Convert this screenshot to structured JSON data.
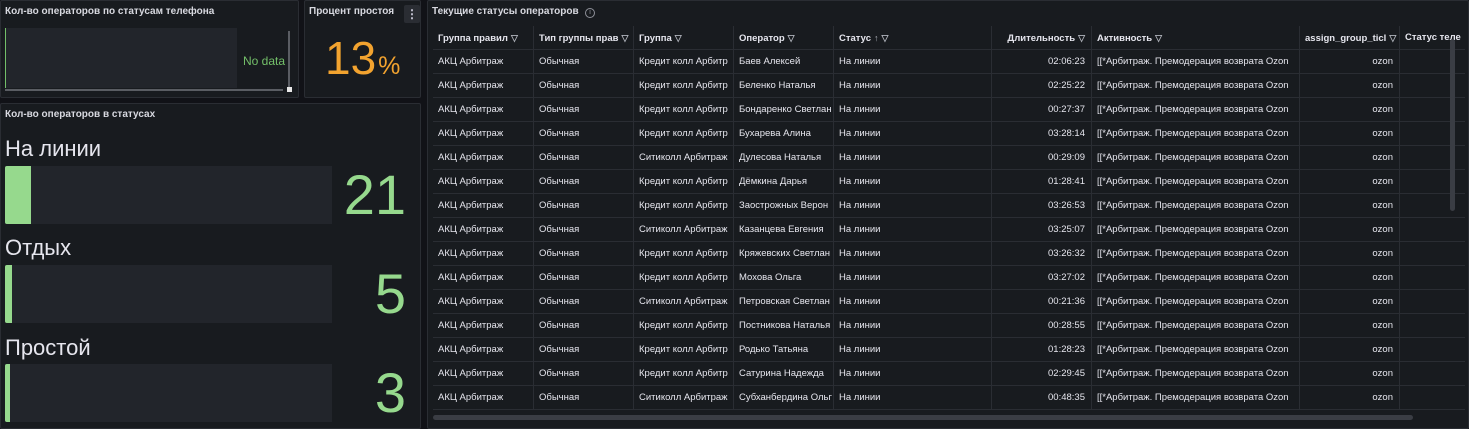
{
  "panel_phone": {
    "title": "Кол-во операторов по статусам телефона",
    "nodata": "No data"
  },
  "panel_idle": {
    "title": "Процент простоя",
    "menu_icon": "kebab-icon",
    "value": "13",
    "unit": "%",
    "color": "#f2a32f"
  },
  "panel_counts": {
    "title": "Кол-во операторов в статусах",
    "items": [
      {
        "label": "На линии",
        "value": "21",
        "fraction": 0.08
      },
      {
        "label": "Отдых",
        "value": "5",
        "fraction": 0.02
      },
      {
        "label": "Простой",
        "value": "3",
        "fraction": 0.012
      }
    ],
    "color": "#96d98d"
  },
  "panel_table": {
    "title": "Текущие статусы операторов",
    "info_icon": "info-icon",
    "columns": [
      "Группа правил",
      "Тип группы прав",
      "Группа",
      "Оператор",
      "Статус",
      "Длительность",
      "Активность",
      "assign_group_ticl",
      "Статус теле"
    ],
    "sort_icon": "↑",
    "rows": [
      [
        "АКЦ Арбитраж",
        "Обычная",
        "Кредит колл Арбитр",
        "Баев Алексей",
        "На линии",
        "02:06:23",
        "[[*Арбитраж. Премодерация возврата Ozon",
        "ozon"
      ],
      [
        "АКЦ Арбитраж",
        "Обычная",
        "Кредит колл Арбитр",
        "Беленко Наталья",
        "На линии",
        "02:25:22",
        "[[*Арбитраж. Премодерация возврата Ozon",
        "ozon"
      ],
      [
        "АКЦ Арбитраж",
        "Обычная",
        "Кредит колл Арбитр",
        "Бондаренко Светлан",
        "На линии",
        "00:27:37",
        "[[*Арбитраж. Премодерация возврата Ozon",
        "ozon"
      ],
      [
        "АКЦ Арбитраж",
        "Обычная",
        "Кредит колл Арбитр",
        "Бухарева Алина",
        "На линии",
        "03:28:14",
        "[[*Арбитраж. Премодерация возврата Ozon",
        "ozon"
      ],
      [
        "АКЦ Арбитраж",
        "Обычная",
        "Ситиколл Арбитраж",
        "Дулесова Наталья",
        "На линии",
        "00:29:09",
        "[[*Арбитраж. Премодерация возврата Ozon",
        "ozon"
      ],
      [
        "АКЦ Арбитраж",
        "Обычная",
        "Кредит колл Арбитр",
        "Дёмкина Дарья",
        "На линии",
        "01:28:41",
        "[[*Арбитраж. Премодерация возврата Ozon",
        "ozon"
      ],
      [
        "АКЦ Арбитраж",
        "Обычная",
        "Кредит колл Арбитр",
        "Заострожных Верон",
        "На линии",
        "03:26:53",
        "[[*Арбитраж. Премодерация возврата Ozon",
        "ozon"
      ],
      [
        "АКЦ Арбитраж",
        "Обычная",
        "Ситиколл Арбитраж",
        "Казанцева Евгения",
        "На линии",
        "03:25:07",
        "[[*Арбитраж. Премодерация возврата Ozon",
        "ozon"
      ],
      [
        "АКЦ Арбитраж",
        "Обычная",
        "Кредит колл Арбитр",
        "Кряжевских Светлан",
        "На линии",
        "03:26:32",
        "[[*Арбитраж. Премодерация возврата Ozon",
        "ozon"
      ],
      [
        "АКЦ Арбитраж",
        "Обычная",
        "Кредит колл Арбитр",
        "Мохова Ольга",
        "На линии",
        "03:27:02",
        "[[*Арбитраж. Премодерация возврата Ozon",
        "ozon"
      ],
      [
        "АКЦ Арбитраж",
        "Обычная",
        "Ситиколл Арбитраж",
        "Петровская Светлан",
        "На линии",
        "00:21:36",
        "[[*Арбитраж. Премодерация возврата Ozon",
        "ozon"
      ],
      [
        "АКЦ Арбитраж",
        "Обычная",
        "Кредит колл Арбитр",
        "Постникова Наталья",
        "На линии",
        "00:28:55",
        "[[*Арбитраж. Премодерация возврата Ozon",
        "ozon"
      ],
      [
        "АКЦ Арбитраж",
        "Обычная",
        "Кредит колл Арбитр",
        "Родько Татьяна",
        "На линии",
        "01:28:23",
        "[[*Арбитраж. Премодерация возврата Ozon",
        "ozon"
      ],
      [
        "АКЦ Арбитраж",
        "Обычная",
        "Кредит колл Арбитр",
        "Сатурина Надежда",
        "На линии",
        "02:29:45",
        "[[*Арбитраж. Премодерация возврата Ozon",
        "ozon"
      ],
      [
        "АКЦ Арбитраж",
        "Обычная",
        "Ситиколл Арбитраж",
        "Субханбердина Ольг",
        "На линии",
        "00:48:35",
        "[[*Арбитраж. Премодерация возврата Ozon",
        "ozon"
      ]
    ]
  }
}
